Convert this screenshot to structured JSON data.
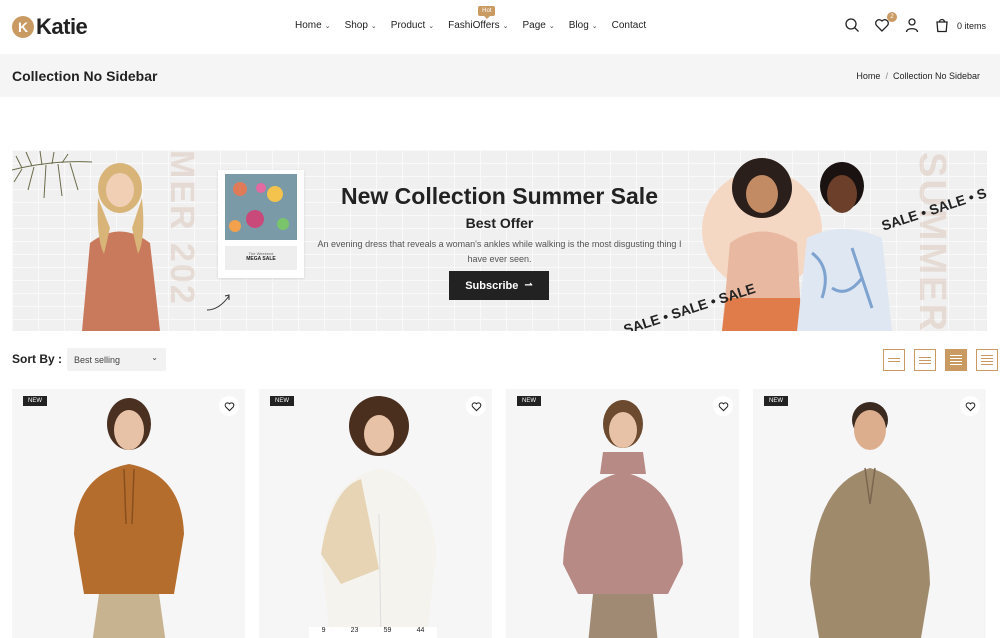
{
  "header": {
    "logo_mark": "K",
    "logo_text": "Katie",
    "nav": [
      {
        "label": "Home"
      },
      {
        "label": "Shop"
      },
      {
        "label": "Product"
      },
      {
        "label": "FashiOffers",
        "badge": "Hot"
      },
      {
        "label": "Page"
      },
      {
        "label": "Blog"
      },
      {
        "label": "Contact"
      }
    ],
    "wishlist_count": "2",
    "cart_label": "0 items"
  },
  "titlebar": {
    "title": "Collection No Sidebar",
    "breadcrumb": [
      "Home",
      "/",
      "Collection No Sidebar"
    ]
  },
  "banner": {
    "heading": "New Collection Summer Sale",
    "subheading": "Best Offer",
    "description": "An evening dress that reveals a woman's ankles while walking is the most disgusting thing I have ever seen.",
    "button_label": "Subscribe",
    "card_top": "The Weekend",
    "card_label": "MEGA SALE",
    "vertical_text_right": "SUMMER",
    "vertical_text_left": "MER 202",
    "sale_strip_1": "SALE • SALE • SALE",
    "sale_strip_2": "SALE • SALE • SALE"
  },
  "toolbar": {
    "sort_label": "Sort By :",
    "sort_value": "Best selling"
  },
  "products": [
    {
      "badge": "NEW"
    },
    {
      "badge": "NEW",
      "countdown": [
        "9",
        "23",
        "59",
        "44"
      ]
    },
    {
      "badge": "NEW"
    },
    {
      "badge": "NEW"
    }
  ],
  "colors": {
    "accent": "#c99a62",
    "dark": "#222222",
    "titlebar_bg": "#f5f5f5",
    "card_bg": "#f6f6f6"
  }
}
